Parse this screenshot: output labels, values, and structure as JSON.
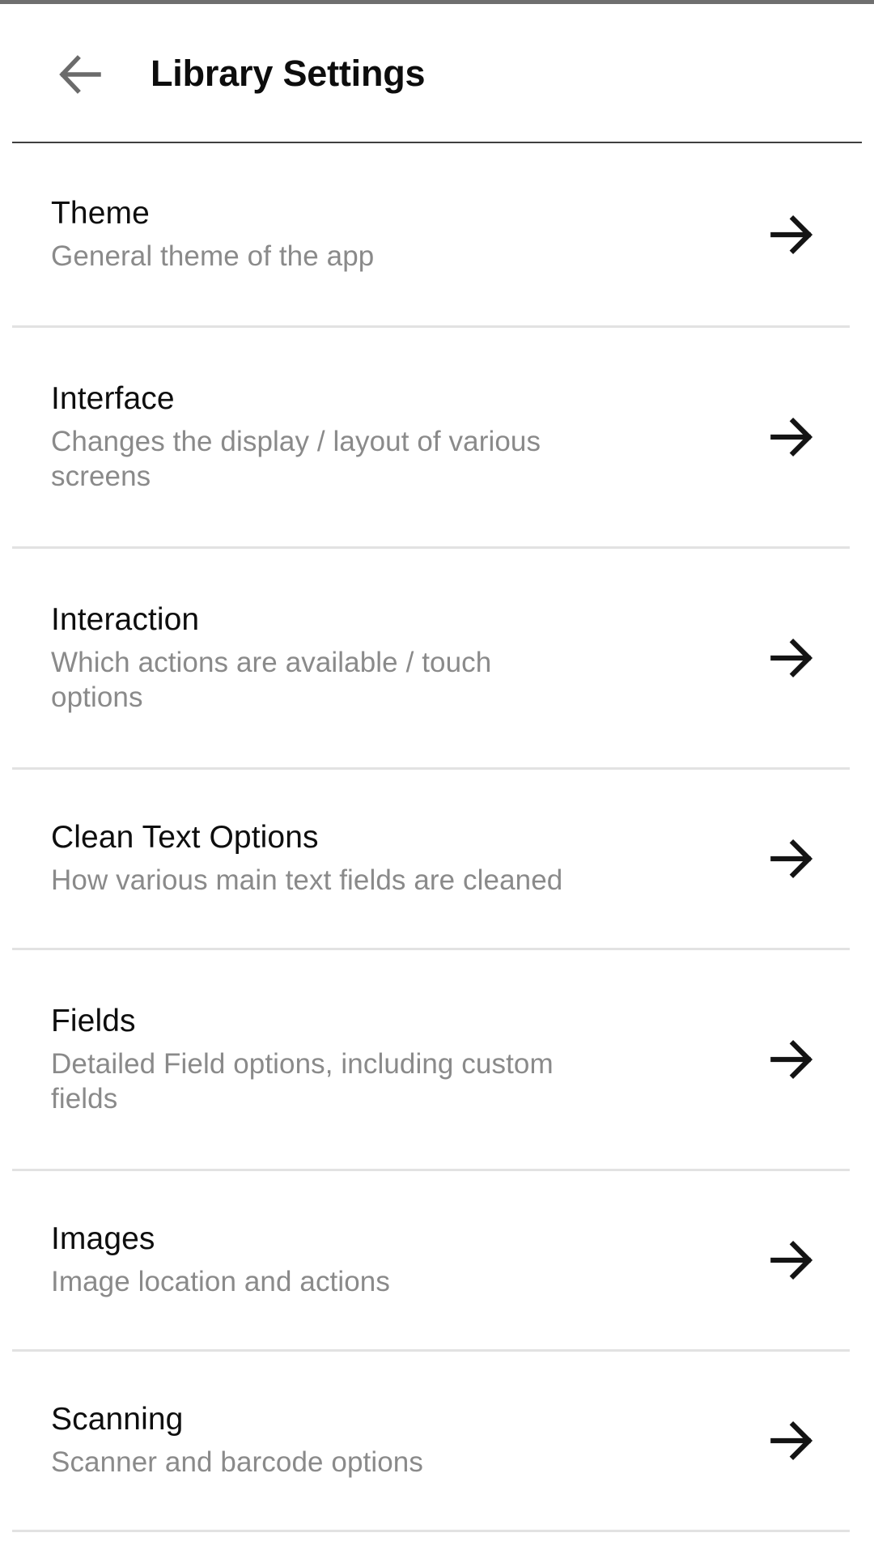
{
  "window": {
    "status_bar_color": "#6f6f6f",
    "background": "#ffffff"
  },
  "header": {
    "back_icon": "arrow-left-icon",
    "back_icon_color": "#6b6b6b",
    "title": "Library Settings",
    "title_color": "#0d0d0d",
    "divider_color": "#3f3f3f"
  },
  "list": {
    "chevron_icon": "arrow-right-icon",
    "chevron_color": "#141414",
    "divider_color": "#e2e2e2",
    "title_color": "#0e0e0e",
    "subtitle_color": "#8a8a8a",
    "items": [
      {
        "title": "Theme",
        "subtitle": "General theme of the app"
      },
      {
        "title": "Interface",
        "subtitle": "Changes the display / layout of various screens"
      },
      {
        "title": "Interaction",
        "subtitle": "Which actions are available / touch options"
      },
      {
        "title": "Clean Text Options",
        "subtitle": "How various main text fields are cleaned"
      },
      {
        "title": "Fields",
        "subtitle": "Detailed Field options, including custom fields"
      },
      {
        "title": "Images",
        "subtitle": "Image location and actions"
      },
      {
        "title": "Scanning",
        "subtitle": "Scanner and barcode options"
      }
    ]
  }
}
